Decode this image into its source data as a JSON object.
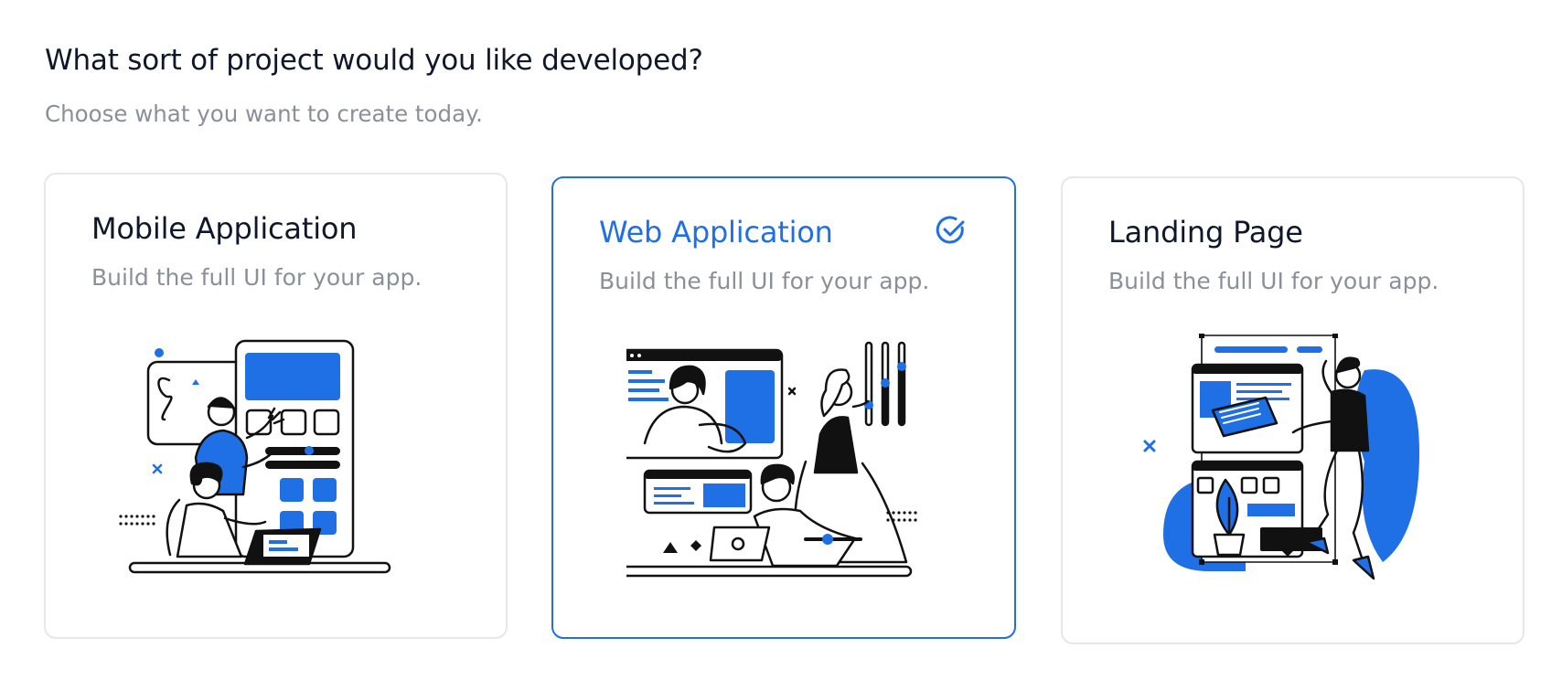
{
  "page": {
    "heading": "What sort of project would you like developed?",
    "subheading": "Choose what you want to create today."
  },
  "cards": [
    {
      "title": "Mobile Application",
      "description": "Build the full UI for your app.",
      "selected": false,
      "illustration": "mobile-app-illustration"
    },
    {
      "title": "Web Application",
      "description": "Build the full UI for your app.",
      "selected": true,
      "illustration": "web-app-illustration"
    },
    {
      "title": "Landing Page",
      "description": "Build the full UI for your app.",
      "selected": false,
      "illustration": "landing-page-illustration"
    }
  ],
  "colors": {
    "accent": "#1f6fe5",
    "title": "#0f172a",
    "muted": "#8a8f9a",
    "border": "#e5e7eb",
    "ink": "#111111"
  },
  "icons": {
    "selected_indicator": "check-circle-icon"
  }
}
